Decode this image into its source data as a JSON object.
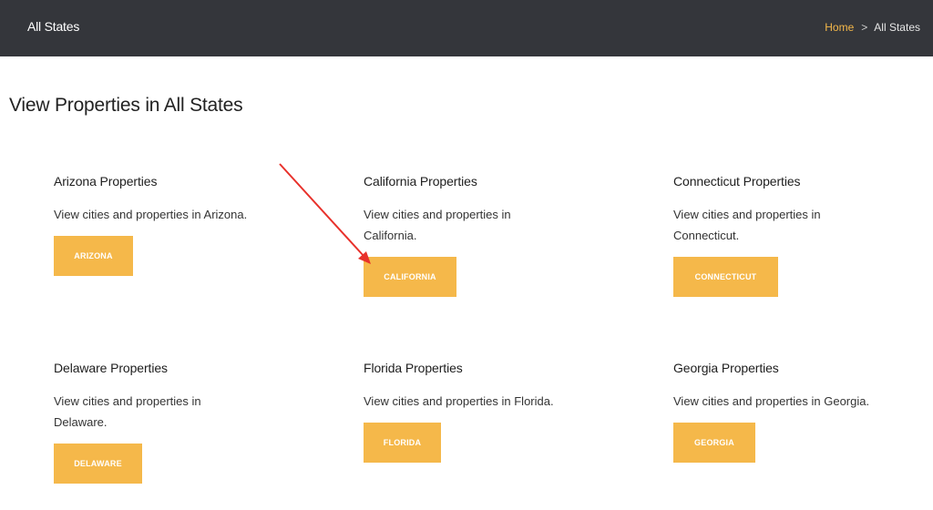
{
  "header": {
    "page_name": "All States",
    "breadcrumb": {
      "home": "Home",
      "separator": ">",
      "current": "All States"
    }
  },
  "main": {
    "title": "View Properties in All States",
    "states": [
      {
        "title": "Arizona Properties",
        "description": "View cities and properties in Arizona.",
        "button": "ARIZONA"
      },
      {
        "title": "California Properties",
        "description": "View cities and properties in California.",
        "button": "CALIFORNIA"
      },
      {
        "title": "Connecticut Properties",
        "description": "View cities and properties in Connecticut.",
        "button": "CONNECTICUT"
      },
      {
        "title": "Delaware Properties",
        "description": "View cities and properties in Delaware.",
        "button": "DELAWARE"
      },
      {
        "title": "Florida Properties",
        "description": "View cities and properties in Florida.",
        "button": "FLORIDA"
      },
      {
        "title": "Georgia Properties",
        "description": "View cities and properties in Georgia.",
        "button": "GEORGIA"
      }
    ]
  },
  "colors": {
    "header_bg": "#34363b",
    "accent": "#f5b84a",
    "annotation_arrow": "#e8312b"
  }
}
